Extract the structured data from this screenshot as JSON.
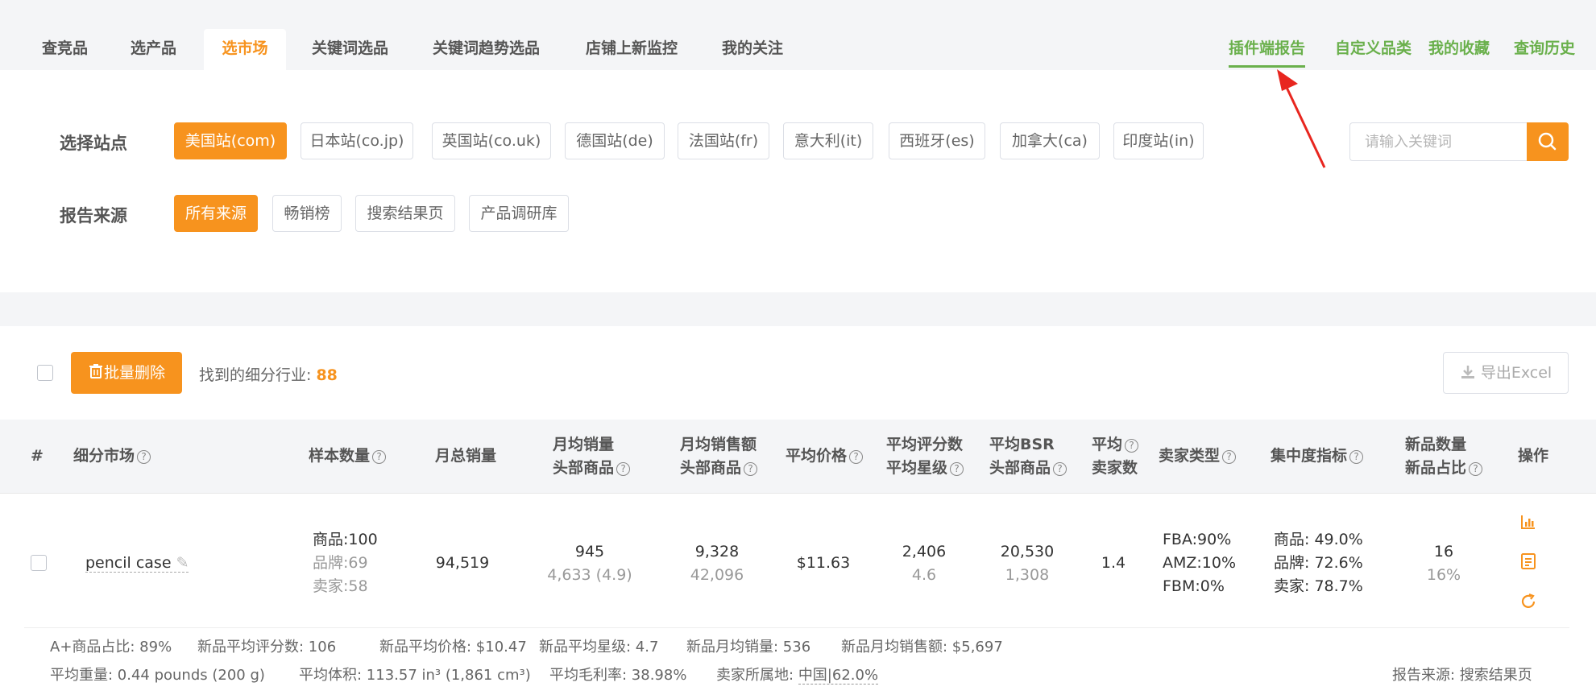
{
  "nav": {
    "tabs": [
      "查竞品",
      "选产品",
      "选市场",
      "关键词选品",
      "关键词趋势选品",
      "店铺上新监控",
      "我的关注"
    ],
    "right_links": [
      "插件端报告",
      "自定义品类",
      "我的收藏",
      "查询历史"
    ]
  },
  "filter": {
    "site_label": "选择站点",
    "sites": [
      "美国站(com)",
      "日本站(co.jp)",
      "英国站(co.uk)",
      "德国站(de)",
      "法国站(fr)",
      "意大利(it)",
      "西班牙(es)",
      "加拿大(ca)",
      "印度站(in)"
    ],
    "source_label": "报告来源",
    "sources": [
      "所有来源",
      "畅销榜",
      "搜索结果页",
      "产品调研库"
    ],
    "search_placeholder": "请输入关键词"
  },
  "toolbar": {
    "batch_delete": "批量删除",
    "found_label": "找到的细分行业:",
    "found_count": "88",
    "export": "导出Excel"
  },
  "table": {
    "headers": {
      "index": "#",
      "market": "细分市场",
      "samples": "样本数量",
      "monthly_sales": "月总销量",
      "avg_sales_l1": "月均销量",
      "avg_sales_l2": "头部商品",
      "avg_revenue_l1": "月均销售额",
      "avg_revenue_l2": "头部商品",
      "avg_price": "平均价格",
      "avg_rating_l1": "平均评分数",
      "avg_rating_l2": "平均星级",
      "avg_bsr_l1": "平均BSR",
      "avg_bsr_l2": "头部商品",
      "avg_sellers_l1": "平均",
      "avg_sellers_l2": "卖家数",
      "seller_type": "卖家类型",
      "concentration": "集中度指标",
      "new_l1": "新品数量",
      "new_l2": "新品占比",
      "ops": "操作"
    },
    "row": {
      "market": "pencil case",
      "samples_products": "商品:100",
      "samples_brands": "品牌:69",
      "samples_sellers": "卖家:58",
      "monthly_sales": "94,519",
      "avg_sales": "945",
      "avg_sales_head": "4,633 (4.9)",
      "avg_revenue": "9,328",
      "avg_revenue_head": "42,096",
      "avg_price": "$11.63",
      "avg_reviews": "2,406",
      "avg_stars": "4.6",
      "avg_bsr": "20,530",
      "avg_bsr_head": "1,308",
      "avg_sellers": "1.4",
      "fba": "FBA:90%",
      "amz": "AMZ:10%",
      "fbm": "FBM:0%",
      "conc_products": "商品: 49.0%",
      "conc_brands": "品牌: 72.6%",
      "conc_sellers": "卖家: 78.7%",
      "new_count": "16",
      "new_ratio": "16%"
    },
    "extra": {
      "aplus": "A+商品占比: 89%",
      "new_reviews": "新品平均评分数: 106",
      "new_price": "新品平均价格: $10.47",
      "new_stars": "新品平均星级: 4.7",
      "new_sales": "新品月均销量: 536",
      "new_revenue": "新品月均销售额: $5,697",
      "weight": "平均重量: 0.44 pounds (200 g)",
      "volume": "平均体积: 113.57 in³ (1,861 cm³)",
      "margin": "平均毛利率: 38.98%",
      "origin_label": "卖家所属地:",
      "origin_value": "中国|62.0%",
      "report_source": "报告来源: 搜索结果页"
    }
  },
  "colors": {
    "accent": "#f7931e",
    "green": "#6ab04c",
    "annotation": "#e8261f"
  }
}
